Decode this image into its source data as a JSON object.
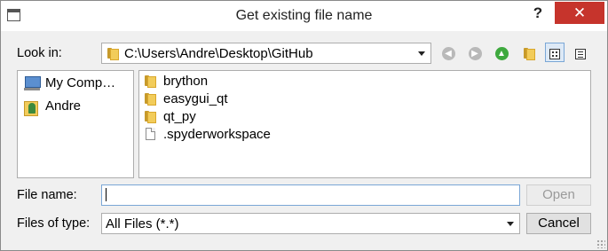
{
  "window": {
    "title": "Get existing file name",
    "help_label": "?",
    "close_label": "✕"
  },
  "look_in": {
    "label": "Look in:",
    "path": "C:\\Users\\Andre\\Desktop\\GitHub"
  },
  "toolbar": {
    "back_icon": "back-arrow-icon",
    "forward_icon": "forward-arrow-icon",
    "up_icon": "up-folder-icon",
    "new_folder_icon": "new-folder-icon",
    "detail_view_icon": "icon-view-icon",
    "list_view_icon": "list-view-icon"
  },
  "sidebar": {
    "items": [
      {
        "label": "My Comp…",
        "icon": "computer-icon"
      },
      {
        "label": "Andre",
        "icon": "user-folder-icon"
      }
    ]
  },
  "files": {
    "items": [
      {
        "label": "brython",
        "type": "folder"
      },
      {
        "label": "easygui_qt",
        "type": "folder"
      },
      {
        "label": "qt_py",
        "type": "folder"
      },
      {
        "label": ".spyderworkspace",
        "type": "file"
      }
    ]
  },
  "file_name": {
    "label": "File name:",
    "value": ""
  },
  "file_type": {
    "label": "Files of type:",
    "value": "All Files (*.*)"
  },
  "buttons": {
    "open_label": "Open",
    "cancel_label": "Cancel"
  },
  "colors": {
    "close_button": "#c6342c",
    "focus_border": "#7aa7d6",
    "folder": "#f2cc5a",
    "up_arrow": "#3ea93e"
  }
}
